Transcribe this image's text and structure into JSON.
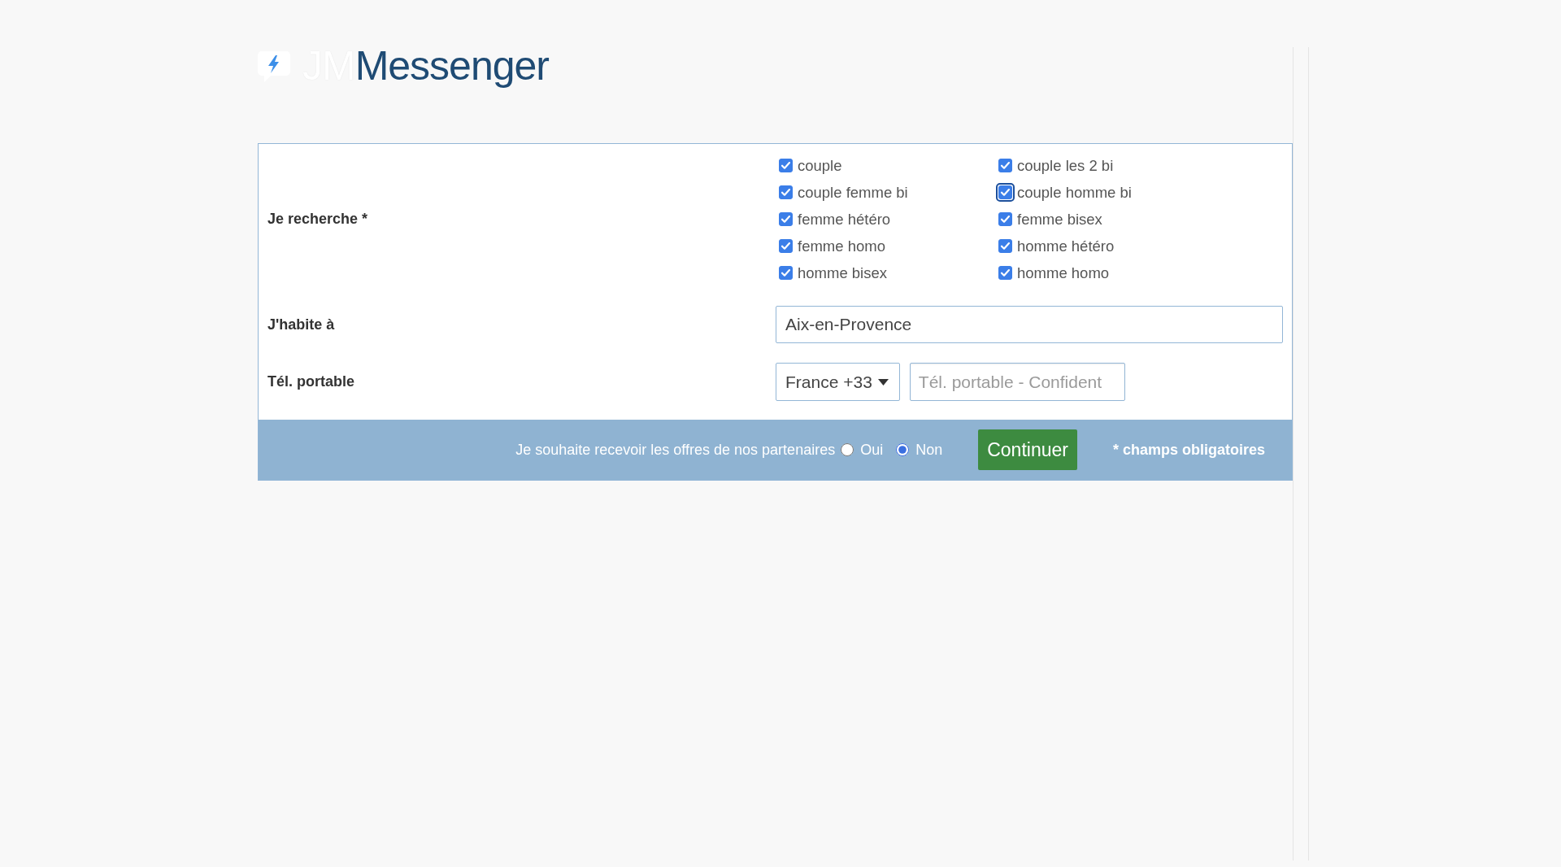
{
  "logo": {
    "prefix": "JM",
    "name": "Messenger"
  },
  "form": {
    "fields": [
      {
        "kind": "checkboxes",
        "label": "Je recherche *",
        "options": [
          {
            "label": "couple",
            "checked": true,
            "focused": false
          },
          {
            "label": "couple les 2 bi",
            "checked": true,
            "focused": false
          },
          {
            "label": "couple femme bi",
            "checked": true,
            "focused": false
          },
          {
            "label": "couple homme bi",
            "checked": true,
            "focused": true
          },
          {
            "label": "femme hétéro",
            "checked": true,
            "focused": false
          },
          {
            "label": "femme bisex",
            "checked": true,
            "focused": false
          },
          {
            "label": "femme homo",
            "checked": true,
            "focused": false
          },
          {
            "label": "homme hétéro",
            "checked": true,
            "focused": false
          },
          {
            "label": "homme bisex",
            "checked": true,
            "focused": false
          },
          {
            "label": "homme homo",
            "checked": true,
            "focused": false
          }
        ]
      },
      {
        "kind": "text",
        "label": "J'habite à",
        "value": "Aix-en-Provence"
      },
      {
        "kind": "phone",
        "label": "Tél. portable",
        "country": "France +33",
        "placeholder": "Tél. portable - Confident"
      }
    ]
  },
  "footer": {
    "consent": {
      "label": "Je souhaite recevoir les offres de nos partenaires",
      "options": [
        {
          "label": "Oui",
          "selected": false
        },
        {
          "label": "Non",
          "selected": true
        }
      ]
    },
    "button": "Continuer",
    "note": "* champs obligatoires"
  }
}
